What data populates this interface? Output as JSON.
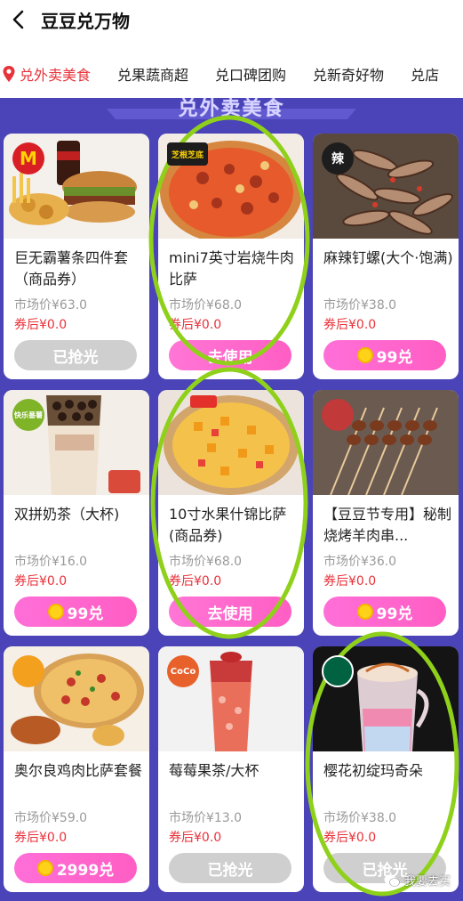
{
  "header": {
    "title": "豆豆兑万物"
  },
  "tabs": [
    {
      "label": "兑外卖美食",
      "active": true
    },
    {
      "label": "兑果蔬商超"
    },
    {
      "label": "兑口碑团购"
    },
    {
      "label": "兑新奇好物"
    },
    {
      "label": "兑店"
    }
  ],
  "section": {
    "title": "兑外卖美食"
  },
  "products": [
    {
      "name": "巨无霸薯条四件套（商品券）",
      "market": "市场价¥63.0",
      "coupon": "券后¥0.0",
      "action": "已抢光",
      "action_type": "sold",
      "logo": "M"
    },
    {
      "name": "mini7英寸岩烧牛肉比萨",
      "market": "市场价¥68.0",
      "coupon": "券后¥0.0",
      "action": "去使用",
      "action_type": "use",
      "logo": "芝根芝底"
    },
    {
      "name": "麻辣钉螺(大个·饱满)",
      "market": "市场价¥38.0",
      "coupon": "券后¥0.0",
      "action": "99兑",
      "action_type": "redeem",
      "logo": "辣"
    },
    {
      "name": "双拼奶茶（大杯)",
      "market": "市场价¥16.0",
      "coupon": "券后¥0.0",
      "action": "99兑",
      "action_type": "redeem",
      "logo": "快乐番薯"
    },
    {
      "name": "10寸水果什锦比萨(商品券)",
      "market": "市场价¥68.0",
      "coupon": "券后¥0.0",
      "action": "去使用",
      "action_type": "use",
      "logo": ""
    },
    {
      "name": "【豆豆节专用】秘制烧烤羊肉串...",
      "market": "市场价¥36.0",
      "coupon": "券后¥0.0",
      "action": "99兑",
      "action_type": "redeem",
      "logo": ""
    },
    {
      "name": "奥尔良鸡肉比萨套餐",
      "market": "市场价¥59.0",
      "coupon": "券后¥0.0",
      "action": "2999兑",
      "action_type": "redeem",
      "logo": ""
    },
    {
      "name": "莓莓果茶/大杯",
      "market": "市场价¥13.0",
      "coupon": "券后¥0.0",
      "action": "已抢光",
      "action_type": "sold",
      "logo": "CoCo"
    },
    {
      "name": "樱花初绽玛奇朵",
      "market": "市场价¥38.0",
      "coupon": "券后¥0.0",
      "action": "已抢光",
      "action_type": "sold",
      "logo": ""
    }
  ],
  "watermark": {
    "text": "我要去买"
  },
  "colors": {
    "accent": "#e8323a",
    "background": "#4a44b8",
    "button_pink": "#ff5ec3",
    "button_gray": "#cfcfcf",
    "annotation": "#8fd11a"
  }
}
